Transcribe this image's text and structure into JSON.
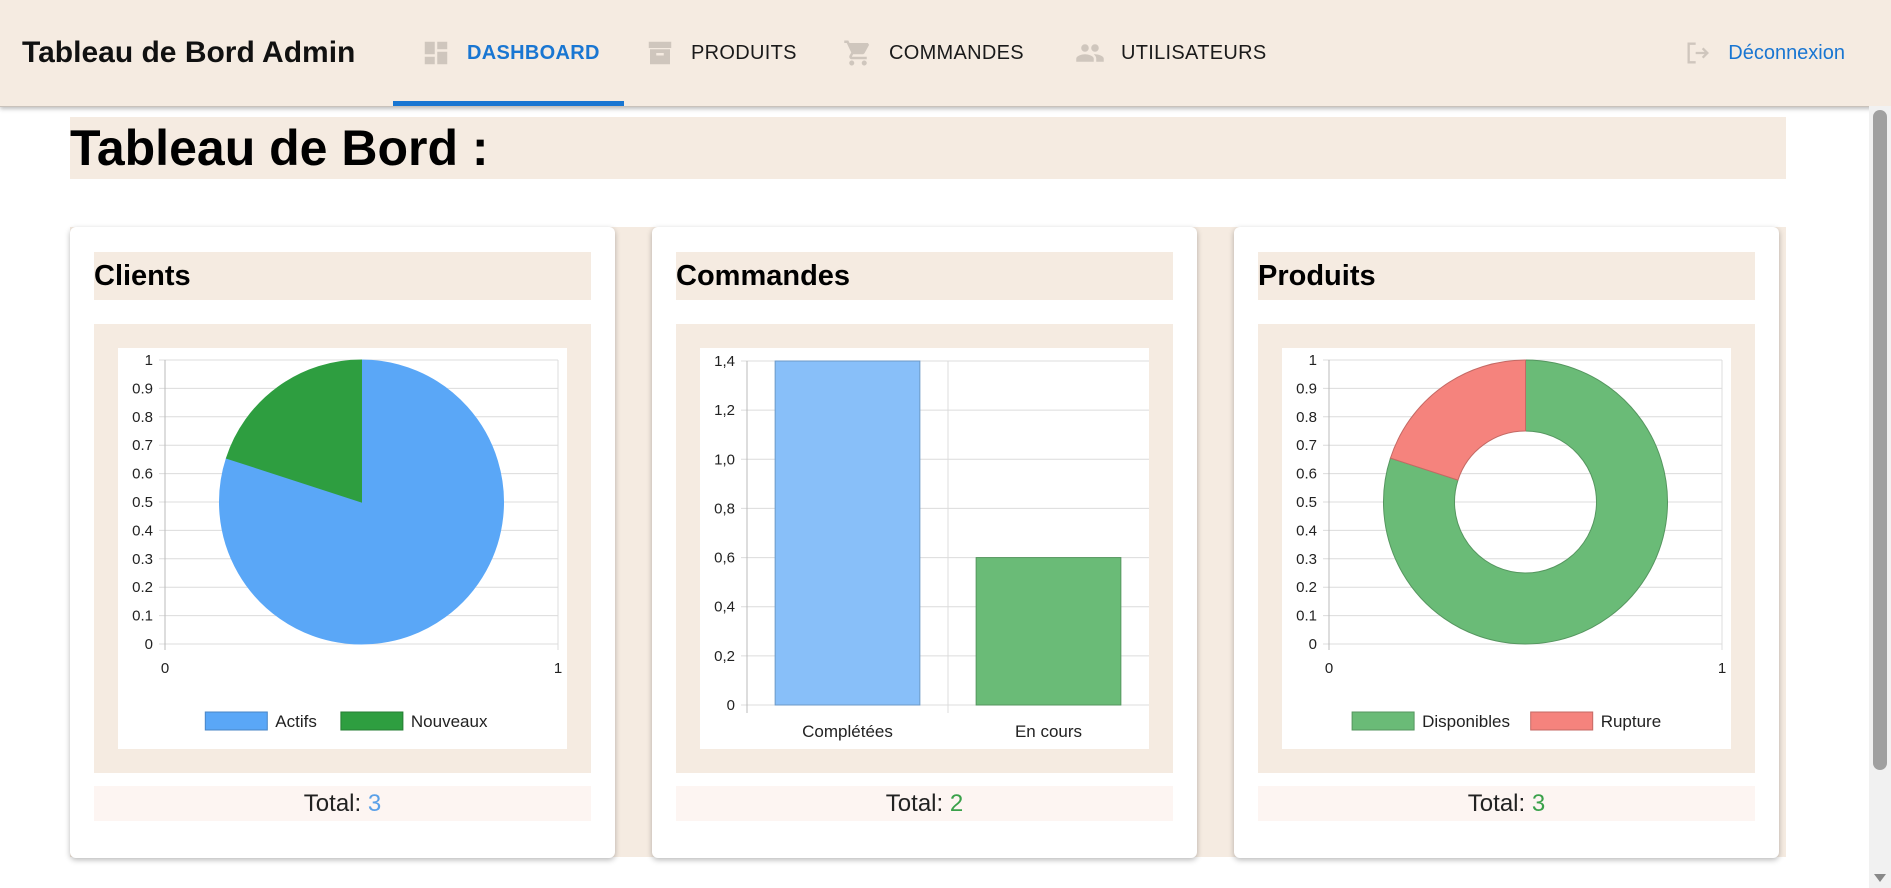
{
  "navbar": {
    "brand": "Tableau de Bord Admin",
    "items": [
      {
        "label": "DASHBOARD",
        "icon": "dashboard-icon",
        "active": true
      },
      {
        "label": "PRODUITS",
        "icon": "archive-box-icon",
        "active": false
      },
      {
        "label": "COMMANDES",
        "icon": "shopping-cart-icon",
        "active": false
      },
      {
        "label": "UTILISATEURS",
        "icon": "people-icon",
        "active": false
      }
    ],
    "logout": {
      "label": "Déconnexion",
      "icon": "logout-icon"
    }
  },
  "page": {
    "title": "Tableau de Bord :"
  },
  "colors": {
    "accent": "#1976d2",
    "panel": "#f5ebe1",
    "blue": "#5aa0e8",
    "green": "#3aa14a",
    "red": "#f08080"
  },
  "cards": [
    {
      "title": "Clients",
      "total_label": "Total:",
      "total_value": "3"
    },
    {
      "title": "Commandes",
      "total_label": "Total:",
      "total_value": "2"
    },
    {
      "title": "Produits",
      "total_label": "Total:",
      "total_value": "3"
    }
  ],
  "chart_data": [
    {
      "type": "pie",
      "title": "",
      "labels": [
        "Actifs",
        "Nouveaux"
      ],
      "values": [
        0.8,
        0.2
      ],
      "colors": [
        "#5aa7f7",
        "#2e9e40"
      ],
      "y_ticks": [
        "0",
        "0.1",
        "0.2",
        "0.3",
        "0.4",
        "0.5",
        "0.6",
        "0.7",
        "0.8",
        "0.9",
        "1"
      ],
      "x_ticks": [
        "0",
        "1"
      ],
      "grid": true,
      "legend": "bottom"
    },
    {
      "type": "bar",
      "title": "",
      "categories": [
        "Complétées",
        "En cours"
      ],
      "values": [
        1.4,
        0.6
      ],
      "colors": [
        "#88bff9",
        "#6abb77"
      ],
      "ylim": [
        0,
        1.4
      ],
      "y_ticks": [
        "0",
        "0,2",
        "0,4",
        "0,6",
        "0,8",
        "1,0",
        "1,2",
        "1,4"
      ],
      "grid": true,
      "legend": "none"
    },
    {
      "type": "pie",
      "variant": "doughnut",
      "title": "",
      "labels": [
        "Disponibles",
        "Rupture"
      ],
      "values": [
        0.8,
        0.2
      ],
      "colors": [
        "#6abb77",
        "#f5837d"
      ],
      "y_ticks": [
        "0",
        "0.1",
        "0.2",
        "0.3",
        "0.4",
        "0.5",
        "0.6",
        "0.7",
        "0.8",
        "0.9",
        "1"
      ],
      "x_ticks": [
        "0",
        "1"
      ],
      "grid": true,
      "legend": "bottom"
    }
  ]
}
